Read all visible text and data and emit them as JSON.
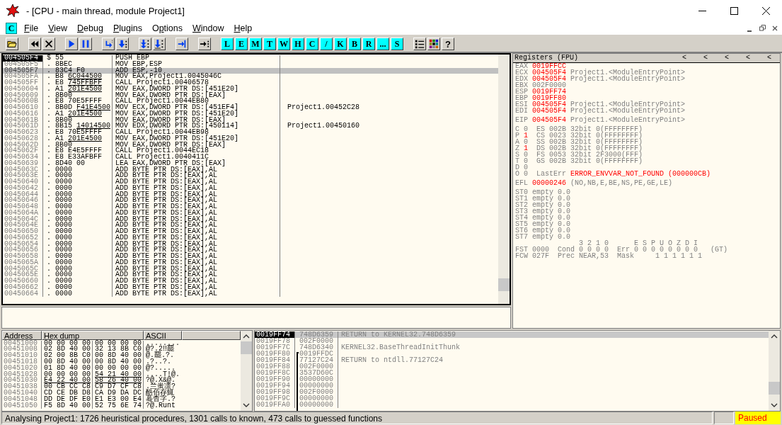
{
  "window": {
    "title": "- [CPU - main thread, module Project1]"
  },
  "menu": {
    "badge": "C",
    "items": [
      {
        "key": "F",
        "after": "ile"
      },
      {
        "key": "V",
        "after": "iew"
      },
      {
        "key": "D",
        "after": "ebug"
      },
      {
        "key": "P",
        "after": "lugins"
      },
      {
        "before": "O",
        "key": "p",
        "after": "tions"
      },
      {
        "key": "W",
        "after": "indow"
      },
      {
        "key": "H",
        "after": "elp"
      }
    ]
  },
  "toolbar": {
    "window_buttons": [
      "L",
      "E",
      "M",
      "T",
      "W",
      "H",
      "C",
      "/",
      "K",
      "B",
      "R",
      "...",
      "S"
    ],
    "help": "?"
  },
  "disassembly": {
    "rows": [
      {
        "address": "004505F4",
        "flag": "$",
        "hex": "55",
        "instruction": "PUSH EBP",
        "eip": true,
        "selected": false
      },
      {
        "address": "004505F5",
        "flag": ".",
        "hex": "8BEC",
        "instruction": "MOV EBP,ESP",
        "eip": false,
        "selected": false
      },
      {
        "address": "004505F7",
        "flag": ".",
        "hex": "83C4 F0",
        "instruction": "ADD ESP,-10",
        "eip": false,
        "selected": true
      },
      {
        "address": "004505FA",
        "flag": ".",
        "hex": "B8",
        "fixup": "6C044500",
        "instruction": "MOV EAX,Project1.0045046C",
        "eip": false,
        "selected": false
      },
      {
        "address": "004505FF",
        "flag": ".",
        "hex": "E8",
        "fixup": "745FFBFF",
        "instruction": "CALL Project1.00406578",
        "eip": false,
        "selected": false
      },
      {
        "address": "00450604",
        "flag": ".",
        "hex": "A1",
        "fixup": "201E4500",
        "instruction": "MOV EAX,DWORD PTR DS:[451E20]",
        "eip": false,
        "selected": false
      },
      {
        "address": "00450609",
        "flag": ".",
        "hex": "8B00",
        "instruction": "MOV EAX,DWORD PTR DS:[EAX]",
        "eip": false,
        "selected": false
      },
      {
        "address": "0045060B",
        "flag": ".",
        "hex": "E8 70E5FFFF",
        "instruction": "CALL Project1.0044EB80",
        "eip": false,
        "selected": false
      },
      {
        "address": "00450610",
        "flag": ".",
        "hex": "8B0D",
        "fixup": "F41E4500",
        "instruction": "MOV ECX,DWORD PTR DS:[451EF4]",
        "comment": "Project1.00452C28",
        "eip": false,
        "selected": false
      },
      {
        "address": "00450616",
        "flag": ".",
        "hex": "A1",
        "fixup": "201E4500",
        "instruction": "MOV EAX,DWORD PTR DS:[451E20]",
        "eip": false,
        "selected": false
      },
      {
        "address": "0045061B",
        "flag": ".",
        "hex": "8B00",
        "instruction": "MOV EAX,DWORD PTR DS:[EAX]",
        "eip": false,
        "selected": false
      },
      {
        "address": "0045061D",
        "flag": ".",
        "hex": "8B15",
        "fixup": "14014500",
        "instruction": "MOV EDX,DWORD PTR DS:[450114]",
        "comment": "Project1.00450160",
        "eip": false,
        "selected": false
      },
      {
        "address": "00450623",
        "flag": ".",
        "hex": "E8 70E5FFFF",
        "instruction": "CALL Project1.0044EB98",
        "eip": false,
        "selected": false
      },
      {
        "address": "00450628",
        "flag": ".",
        "hex": "A1",
        "fixup": "201E4500",
        "instruction": "MOV EAX,DWORD PTR DS:[451E20]",
        "eip": false,
        "selected": false
      },
      {
        "address": "0045062D",
        "flag": ".",
        "hex": "8B00",
        "instruction": "MOV EAX,DWORD PTR DS:[EAX]",
        "eip": false,
        "selected": false
      },
      {
        "address": "0045062F",
        "flag": ".",
        "hex": "E8 E4E5FFFF",
        "instruction": "CALL Project1.0044EC18",
        "eip": false,
        "selected": false
      },
      {
        "address": "00450634",
        "flag": ".",
        "hex": "E8 E33AFBFF",
        "instruction": "CALL Project1.0040411C",
        "eip": false,
        "selected": false
      },
      {
        "address": "00450639",
        "flag": ".",
        "hex": "8D40 00",
        "instruction": "LEA EAX,DWORD PTR DS:[EAX]",
        "eip": false,
        "selected": false
      },
      {
        "address": "0045063C",
        "flag": ".",
        "hex": "0000",
        "instruction": "ADD BYTE PTR DS:[EAX],AL",
        "eip": false,
        "selected": false
      },
      {
        "address": "0045063E",
        "flag": ".",
        "hex": "0000",
        "instruction": "ADD BYTE PTR DS:[EAX],AL",
        "eip": false,
        "selected": false
      },
      {
        "address": "00450640",
        "flag": ".",
        "hex": "0000",
        "instruction": "ADD BYTE PTR DS:[EAX],AL",
        "eip": false,
        "selected": false
      },
      {
        "address": "00450642",
        "flag": ".",
        "hex": "0000",
        "instruction": "ADD BYTE PTR DS:[EAX],AL",
        "eip": false,
        "selected": false
      },
      {
        "address": "00450644",
        "flag": ".",
        "hex": "0000",
        "instruction": "ADD BYTE PTR DS:[EAX],AL",
        "eip": false,
        "selected": false
      },
      {
        "address": "00450646",
        "flag": ".",
        "hex": "0000",
        "instruction": "ADD BYTE PTR DS:[EAX],AL",
        "eip": false,
        "selected": false
      },
      {
        "address": "00450648",
        "flag": ".",
        "hex": "0000",
        "instruction": "ADD BYTE PTR DS:[EAX],AL",
        "eip": false,
        "selected": false
      },
      {
        "address": "0045064A",
        "flag": ".",
        "hex": "0000",
        "instruction": "ADD BYTE PTR DS:[EAX],AL",
        "eip": false,
        "selected": false
      },
      {
        "address": "0045064C",
        "flag": ".",
        "hex": "0000",
        "instruction": "ADD BYTE PTR DS:[EAX],AL",
        "eip": false,
        "selected": false
      },
      {
        "address": "0045064E",
        "flag": ".",
        "hex": "0000",
        "instruction": "ADD BYTE PTR DS:[EAX],AL",
        "eip": false,
        "selected": false
      },
      {
        "address": "00450650",
        "flag": ".",
        "hex": "0000",
        "instruction": "ADD BYTE PTR DS:[EAX],AL",
        "eip": false,
        "selected": false
      },
      {
        "address": "00450652",
        "flag": ".",
        "hex": "0000",
        "instruction": "ADD BYTE PTR DS:[EAX],AL",
        "eip": false,
        "selected": false
      },
      {
        "address": "00450654",
        "flag": ".",
        "hex": "0000",
        "instruction": "ADD BYTE PTR DS:[EAX],AL",
        "eip": false,
        "selected": false
      },
      {
        "address": "00450656",
        "flag": ".",
        "hex": "0000",
        "instruction": "ADD BYTE PTR DS:[EAX],AL",
        "eip": false,
        "selected": false
      },
      {
        "address": "00450658",
        "flag": ".",
        "hex": "0000",
        "instruction": "ADD BYTE PTR DS:[EAX],AL",
        "eip": false,
        "selected": false
      },
      {
        "address": "0045065A",
        "flag": ".",
        "hex": "0000",
        "instruction": "ADD BYTE PTR DS:[EAX],AL",
        "eip": false,
        "selected": false
      },
      {
        "address": "0045065C",
        "flag": ".",
        "hex": "0000",
        "instruction": "ADD BYTE PTR DS:[EAX],AL",
        "eip": false,
        "selected": false
      },
      {
        "address": "0045065E",
        "flag": ".",
        "hex": "0000",
        "instruction": "ADD BYTE PTR DS:[EAX],AL",
        "eip": false,
        "selected": false
      },
      {
        "address": "00450660",
        "flag": ".",
        "hex": "0000",
        "instruction": "ADD BYTE PTR DS:[EAX],AL",
        "eip": false,
        "selected": false
      },
      {
        "address": "00450662",
        "flag": ".",
        "hex": "0000",
        "instruction": "ADD BYTE PTR DS:[EAX],AL",
        "eip": false,
        "selected": false
      },
      {
        "address": "00450664",
        "flag": ".",
        "hex": "0000",
        "instruction": "ADD BYTE PTR DS:[EAX],AL",
        "eip": false,
        "selected": false
      }
    ]
  },
  "registers": {
    "title": "Registers (FPU)",
    "arrows": [
      "<",
      "<",
      "<",
      "<",
      "<"
    ],
    "general": [
      {
        "name": "EAX",
        "value": "0019FFCC",
        "changed": true
      },
      {
        "name": "ECX",
        "value": "004505F4",
        "changed": true,
        "comment": "Project1.<ModuleEntryPoint>"
      },
      {
        "name": "EDX",
        "value": "004505F4",
        "changed": true,
        "comment": "Project1.<ModuleEntryPoint>"
      },
      {
        "name": "EBX",
        "value": "002F0000",
        "changed": false
      },
      {
        "name": "ESP",
        "value": "0019FF74",
        "changed": true
      },
      {
        "name": "EBP",
        "value": "0019FF80",
        "changed": true
      },
      {
        "name": "ESI",
        "value": "004505F4",
        "changed": true,
        "comment": "Project1.<ModuleEntryPoint>"
      },
      {
        "name": "EDI",
        "value": "004505F4",
        "changed": true,
        "comment": "Project1.<ModuleEntryPoint>"
      }
    ],
    "eip": {
      "name": "EIP",
      "value": "004505F4",
      "changed": true,
      "comment": "Project1.<ModuleEntryPoint>"
    },
    "flags": [
      {
        "name": "C",
        "value": "0",
        "changed": false,
        "segment": "ES 002B 32bit 0(FFFFFFFF)"
      },
      {
        "name": "P",
        "value": "1",
        "changed": true,
        "segment": "CS 0023 32bit 0(FFFFFFFF)"
      },
      {
        "name": "A",
        "value": "0",
        "changed": false,
        "segment": "SS 002B 32bit 0(FFFFFFFF)"
      },
      {
        "name": "Z",
        "value": "1",
        "changed": true,
        "segment": "DS 002B 32bit 0(FFFFFFFF)"
      },
      {
        "name": "S",
        "value": "0",
        "changed": false,
        "segment": "FS 0053 32bit 2F3000(FFF)"
      },
      {
        "name": "T",
        "value": "0",
        "changed": false,
        "segment": "GS 002B 32bit 0(FFFFFFFF)"
      },
      {
        "name": "D",
        "value": "0",
        "changed": false
      },
      {
        "name": "O",
        "value": "0",
        "changed": false,
        "last_error": {
          "label": "LastErr",
          "value": "ERROR_ENVVAR_NOT_FOUND (000000CB)"
        }
      }
    ],
    "efl": {
      "name": "EFL",
      "value": "00000246",
      "changed": true,
      "decoded": "(NO,NB,E,BE,NS,PE,GE,LE)"
    },
    "fpu": [
      {
        "name": "ST0",
        "tag": "empty",
        "value": "0.0"
      },
      {
        "name": "ST1",
        "tag": "empty",
        "value": "0.0"
      },
      {
        "name": "ST2",
        "tag": "empty",
        "value": "0.0"
      },
      {
        "name": "ST3",
        "tag": "empty",
        "value": "0.0"
      },
      {
        "name": "ST4",
        "tag": "empty",
        "value": "0.0"
      },
      {
        "name": "ST5",
        "tag": "empty",
        "value": "0.0"
      },
      {
        "name": "ST6",
        "tag": "empty",
        "value": "0.0"
      },
      {
        "name": "ST7",
        "tag": "empty",
        "value": "0.0"
      }
    ],
    "fpu_status": [
      "               3 2 1 0      E S P U O Z D I",
      "FST 0000  Cond 0 0 0 0  Err 0 0 0 0 0 0 0 0   (GT)",
      "FCW 027F  Prec NEAR,53  Mask     1 1 1 1 1 1"
    ]
  },
  "dump": {
    "columns": [
      "Address",
      "Hex dump",
      "ASCII"
    ],
    "rows": [
      {
        "address": "00451000",
        "hex": [
          {
            "bytes": "00 00 00 00",
            "fixup": false
          },
          {
            "bytes": "00 00 00 00",
            "fixup": false
          }
        ],
        "ascii": "........"
      },
      {
        "address": "00451008",
        "hex": [
          {
            "bytes": "02 8D 40 00",
            "fixup": false
          },
          {
            "bytes": "32 13 8B C0",
            "fixup": false
          }
        ],
        "ascii": "@?.2‼罷"
      },
      {
        "address": "00451010",
        "hex": [
          {
            "bytes": "02 00 8B C0",
            "fixup": false
          },
          {
            "bytes": "00 8D 40 00",
            "fixup": false
          }
        ],
        "ascii": "@.罷.?."
      },
      {
        "address": "00451018",
        "hex": [
          {
            "bytes": "00 8D 40 00",
            "fixup": false
          },
          {
            "bytes": "00 8D 40 00",
            "fixup": false
          }
        ],
        "ascii": ".?..?."
      },
      {
        "address": "00451020",
        "hex": [
          {
            "bytes": "01 8D 40 00",
            "fixup": false
          },
          {
            "bytes": "00 00 00 00",
            "fixup": false
          }
        ],
        "ascii": "@?....."
      },
      {
        "address": "00451028",
        "hex": [
          {
            "bytes": "00 00 00 00",
            "fixup": false
          },
          {
            "bytes": "54 21 40 00",
            "fixup": true
          }
        ],
        "ascii": "....T!@."
      },
      {
        "address": "00451030",
        "hex": [
          {
            "bytes": "E4 22 40 00",
            "fixup": true
          },
          {
            "bytes": "58 26 40 00",
            "fixup": true
          }
        ],
        "ascii": "?@.X&@."
      },
      {
        "address": "00451038",
        "hex": [
          {
            "bytes": "00 CB CC C8",
            "fixup": false
          },
          {
            "bytes": "C9 D7 CF C8",
            "fixup": false
          }
        ],
        "ascii": ".兰蚩凛?"
      },
      {
        "address": "00451040",
        "hex": [
          {
            "bytes": "CD CE DB D8",
            "fixup": false
          },
          {
            "bytes": "CA D9 DA DC",
            "fixup": false
          }
        ],
        "ascii": "酷佰存鮿"
      },
      {
        "address": "00451048",
        "hex": [
          {
            "bytes": "DD DE DF E0",
            "fixup": false
          },
          {
            "bytes": "E1 E3 00 E4",
            "fixup": false
          }
        ],
        "ascii": "蓦杳字.?"
      },
      {
        "address": "00451050",
        "hex": [
          {
            "bytes": "F5 8D 40 00",
            "fixup": false
          },
          {
            "bytes": "52 75 6E 74",
            "fixup": false
          }
        ],
        "ascii": "?@.Runt"
      }
    ]
  },
  "stack": {
    "rows": [
      {
        "address": "0019FF74",
        "value": "748D6359",
        "comment": "RETURN to KERNEL32.748D6359",
        "selected": true
      },
      {
        "address": "0019FF78",
        "value": "002F0000",
        "selected": false
      },
      {
        "address": "0019FF7C",
        "value": "748D6340",
        "comment": "KERNEL32.BaseThreadInitThunk",
        "selected": false
      },
      {
        "address": "0019FF80",
        "value": "0019FFDC",
        "selected": false
      },
      {
        "address": "0019FF84",
        "value": "77127C24",
        "comment": "RETURN to ntdll.77127C24",
        "selected": false
      },
      {
        "address": "0019FF88",
        "value": "002F0000",
        "selected": false
      },
      {
        "address": "0019FF8C",
        "value": "3537D60C",
        "selected": false
      },
      {
        "address": "0019FF90",
        "value": "00000000",
        "selected": false
      },
      {
        "address": "0019FF94",
        "value": "00000000",
        "selected": false
      },
      {
        "address": "0019FF98",
        "value": "002F0000",
        "selected": false
      },
      {
        "address": "0019FF9C",
        "value": "00000000",
        "selected": false
      },
      {
        "address": "0019FFA0",
        "value": "00000000",
        "selected": false
      }
    ]
  },
  "status_bar": {
    "message": "Analysing Project1: 1726 heuristical procedures, 1301 calls to known, 473 calls to guessed functions",
    "state": "Paused"
  }
}
